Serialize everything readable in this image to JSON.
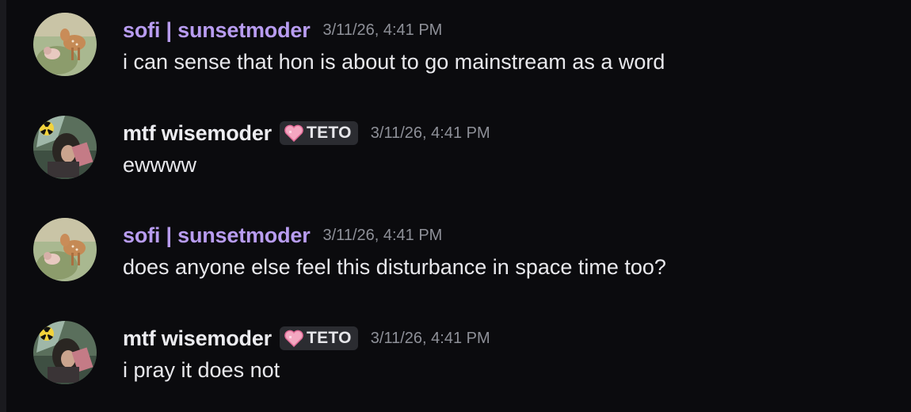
{
  "colors": {
    "background": "#0b0b0e",
    "sofi_name": "#b89cf0",
    "mtf_name": "#ececf0",
    "timestamp": "#8e9098",
    "text": "#e8e8ec",
    "tag_bg": "#2b2c31"
  },
  "messages": [
    {
      "author": "sofi | sunsetmoder",
      "timestamp": "3/11/26, 4:41 PM",
      "text": "i can sense that hon is about to go mainstream as a word",
      "avatar": "fawn-avatar"
    },
    {
      "author": "mtf wisemoder",
      "tag": {
        "icon": "pixel-heart-icon",
        "label": "TETO"
      },
      "timestamp": "3/11/26, 4:41 PM",
      "text": "ewwww",
      "avatar": "anime-girl-avatar"
    },
    {
      "author": "sofi | sunsetmoder",
      "timestamp": "3/11/26, 4:41 PM",
      "text": "does anyone else feel this disturbance in space time too?",
      "avatar": "fawn-avatar"
    },
    {
      "author": "mtf wisemoder",
      "tag": {
        "icon": "pixel-heart-icon",
        "label": "TETO"
      },
      "timestamp": "3/11/26, 4:41 PM",
      "text": "i pray it does not",
      "avatar": "anime-girl-avatar"
    }
  ]
}
